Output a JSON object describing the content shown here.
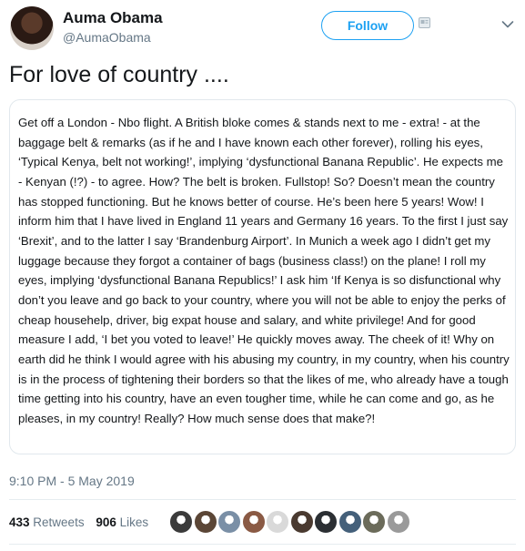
{
  "author": {
    "display_name": "Auma Obama",
    "handle": "@AumaObama"
  },
  "follow_button": {
    "label": "Follow"
  },
  "tweet": {
    "title": "For love of country ....",
    "body": "Get off a London - Nbo flight. A British bloke comes & stands next to me - extra! - at the baggage belt & remarks (as if he and I have known each other forever), rolling his eyes, ‘Typical Kenya, belt not working!’, implying ‘dysfunctional Banana Republic’. He expects me - Kenyan (!?) - to agree. How? The belt is broken. Fullstop! So? Doesn’t mean the country has stopped functioning. But he knows better of course. He’s been here 5 years! Wow! I inform him that I have lived in England 11 years and Germany 16 years. To the first I just say ‘Brexit’, and to the latter I say ‘Brandenburg Airport’. In Munich a week ago I didn’t get my luggage because they forgot a container of bags (business class!) on the plane! I roll my eyes, implying ‘dysfunctional Banana Republics!’ I ask him ‘If Kenya is so disfunctional why don’t you leave and go back to your country, where you will not be able to enjoy the perks of cheap househelp, driver, big expat house and salary, and white privilege! And for good measure I add, ‘I bet you voted to leave!’ He quickly moves away. The cheek of it! Why on earth did he think I would agree with his abusing my country, in my country, when his country is in the process of tightening their borders so that the likes of me, who already have a tough time getting into his country, have an even tougher time, while he can come and go, as he pleases, in my country! Really? How much sense does that make?!",
    "timestamp": "9:10 PM - 5 May 2019"
  },
  "stats": {
    "retweets_count": "433",
    "retweets_label": "Retweets",
    "likes_count": "906",
    "likes_label": "Likes"
  },
  "icons": {
    "badge": "profile-badge-icon",
    "chevron": "chevron-down-icon"
  },
  "colors": {
    "accent": "#1da1f2",
    "secondary_text": "#657786",
    "border": "#e1e8ed"
  },
  "liker_avatars": [
    {
      "name": "liker-avatar-1",
      "color": "#3b3b3b"
    },
    {
      "name": "liker-avatar-2",
      "color": "#5b4636"
    },
    {
      "name": "liker-avatar-3",
      "color": "#7a8fa6"
    },
    {
      "name": "liker-avatar-4",
      "color": "#8a5a44"
    },
    {
      "name": "liker-avatar-5",
      "color": "#d9d9d9"
    },
    {
      "name": "liker-avatar-6",
      "color": "#4a3a30"
    },
    {
      "name": "liker-avatar-7",
      "color": "#2b2f33"
    },
    {
      "name": "liker-avatar-8",
      "color": "#44607a"
    },
    {
      "name": "liker-avatar-9",
      "color": "#6b6b5a"
    },
    {
      "name": "liker-avatar-10",
      "color": "#9a9a9a"
    }
  ]
}
